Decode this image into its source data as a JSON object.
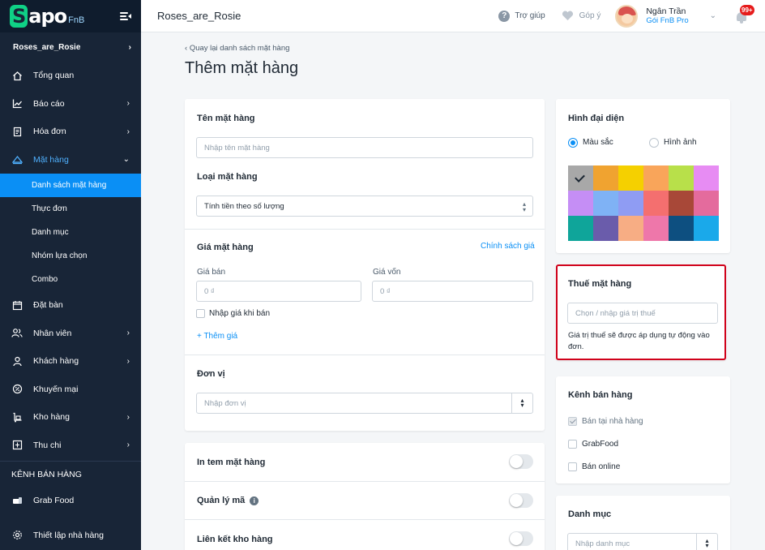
{
  "sidebar": {
    "logo_text": "apo",
    "logo_s": "S",
    "logo_suffix": "FnB",
    "store_name": "Roses_are_Rosie",
    "items": [
      {
        "label": "Tổng quan"
      },
      {
        "label": "Báo cáo"
      },
      {
        "label": "Hóa đơn"
      },
      {
        "label": "Mặt hàng"
      },
      {
        "label": "Đặt bàn"
      },
      {
        "label": "Nhân viên"
      },
      {
        "label": "Khách hàng"
      },
      {
        "label": "Khuyến mại"
      },
      {
        "label": "Kho hàng"
      },
      {
        "label": "Thu chi"
      }
    ],
    "sub_items": [
      {
        "label": "Danh sách mặt hàng"
      },
      {
        "label": "Thực đơn"
      },
      {
        "label": "Danh mục"
      },
      {
        "label": "Nhóm lựa chọn"
      },
      {
        "label": "Combo"
      }
    ],
    "section_label": "KÊNH BÁN HÀNG",
    "grab_food": "Grab Food",
    "settings": "Thiết lập nhà hàng"
  },
  "topbar": {
    "store_title": "Roses_are_Rosie",
    "help": "Trợ giúp",
    "feedback": "Góp ý",
    "user_name": "Ngân Trần",
    "user_plan": "Gói FnB Pro",
    "notification_count": "99+"
  },
  "page": {
    "back_link": "Quay lại danh sách mặt hàng",
    "title": "Thêm mặt hàng"
  },
  "form": {
    "name_label": "Tên mặt hàng",
    "name_placeholder": "Nhập tên mặt hàng",
    "type_label": "Loại mặt hàng",
    "type_value": "Tính tiền theo số lượng",
    "price_label": "Giá mặt hàng",
    "price_policy": "Chính sách giá",
    "sell_price_label": "Giá bán",
    "sell_price_placeholder": "0 ₫",
    "cost_price_label": "Giá vốn",
    "cost_price_placeholder": "0 ₫",
    "enter_price_on_sale": "Nhập giá khi bán",
    "add_price": "+ Thêm giá",
    "unit_label": "Đơn vị",
    "unit_placeholder": "Nhập đơn vị",
    "print_label": "In tem mặt hàng",
    "code_label": "Quản lý mã",
    "stock_label": "Liên kết kho hàng"
  },
  "avatar_card": {
    "title": "Hình đại diện",
    "option_color": "Màu sắc",
    "option_image": "Hình ảnh",
    "colors": [
      "#a8a8a8",
      "#f0a330",
      "#f5d000",
      "#f9a55a",
      "#b8e04a",
      "#e78cf3",
      "#c58ef5",
      "#7fb2f5",
      "#8f9cf3",
      "#f46f6f",
      "#a84838",
      "#e46b9d",
      "#0fa59a",
      "#6a5cab",
      "#f7ad84",
      "#ee77aa",
      "#0d4f80",
      "#1aa9ea"
    ]
  },
  "tax_card": {
    "title": "Thuế mặt hàng",
    "placeholder": "Chọn / nhập giá trị thuế",
    "hint": "Giá trị thuế sẽ được áp dụng tự động vào đơn."
  },
  "channel_card": {
    "title": "Kênh bán hàng",
    "options": [
      {
        "label": "Bán tại nhà hàng",
        "checked": true
      },
      {
        "label": "GrabFood",
        "checked": false
      },
      {
        "label": "Bán online",
        "checked": false
      }
    ]
  },
  "category_card": {
    "title": "Danh mục",
    "placeholder": "Nhập danh mục"
  }
}
